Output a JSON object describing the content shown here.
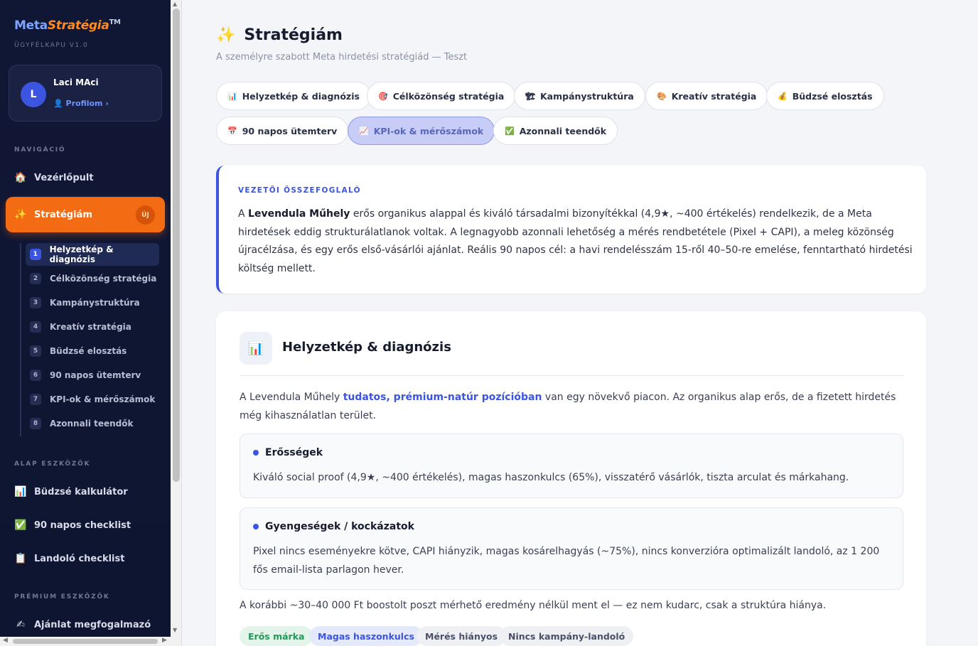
{
  "brand": {
    "part1": "Meta",
    "part2": "Stratégia",
    "tm": "TM",
    "subtitle": "ÜGYFÉLKAPU V1.0"
  },
  "profile": {
    "initial": "L",
    "name": "Laci MAci",
    "link": "Profilom ›"
  },
  "nav": {
    "section_label": "NAVIGÁCIÓ",
    "dashboard": {
      "icon": "🏠",
      "label": "Vezérlőpult"
    },
    "strategy": {
      "icon": "✨",
      "label": "Stratégiám",
      "badge": "ÚJ"
    },
    "sub_items": [
      {
        "num": "1",
        "label": "Helyzetkép & diagnózis"
      },
      {
        "num": "2",
        "label": "Célközönség stratégia"
      },
      {
        "num": "3",
        "label": "Kampánystruktúra"
      },
      {
        "num": "4",
        "label": "Kreatív stratégia"
      },
      {
        "num": "5",
        "label": "Büdzsé elosztás"
      },
      {
        "num": "6",
        "label": "90 napos ütemterv"
      },
      {
        "num": "7",
        "label": "KPI-ok & mérőszámok"
      },
      {
        "num": "8",
        "label": "Azonnali teendők"
      }
    ]
  },
  "basic_tools": {
    "section_label": "ALAP ESZKÖZÖK",
    "items": [
      {
        "icon": "📊",
        "label": "Büdzsé kalkulátor"
      },
      {
        "icon": "✅",
        "label": "90 napos checklist"
      },
      {
        "icon": "📋",
        "label": "Landoló checklist"
      }
    ]
  },
  "premium_tools": {
    "section_label": "PRÉMIUM ESZKÖZÖK",
    "items": [
      {
        "icon": "✍",
        "label": "Ajánlat megfogalmazó"
      }
    ]
  },
  "page": {
    "title_icon": "✨",
    "title": "Stratégiám",
    "subtitle": "A személyre szabott Meta hirdetési stratégiád — Teszt"
  },
  "tabs": [
    {
      "icon": "📊",
      "label": "Helyzetkép & diagnózis"
    },
    {
      "icon": "🎯",
      "label": "Célközönség stratégia"
    },
    {
      "icon": "🏗",
      "label": "Kampánystruktúra"
    },
    {
      "icon": "🎨",
      "label": "Kreatív stratégia"
    },
    {
      "icon": "💰",
      "label": "Büdzsé elosztás"
    },
    {
      "icon": "📅",
      "label": "90 napos ütemterv"
    },
    {
      "icon": "📈",
      "label": "KPI-ok & mérőszámok"
    },
    {
      "icon": "✅",
      "label": "Azonnali teendők"
    }
  ],
  "summary": {
    "label": "VEZETŐI ÖSSZEFOGLALÓ",
    "prefix": "A ",
    "brand_name": "Levendula Műhely",
    "text": " erős organikus alappal és kiváló társadalmi bizonyítékkal (4,9★, ~400 értékelés) rendelkezik, de a Meta hirdetések eddig strukturálatlanok voltak. A legnagyobb azonnali lehetőség a mérés rendbetétele (Pixel + CAPI), a meleg közönség újracélzása, és egy erős első-vásárlói ajánlat. Reális 90 napos cél: a havi rendelésszám 15-ről 40–50-re emelése, fenntartható hirdetési költség mellett."
  },
  "section": {
    "icon": "📊",
    "title": "Helyzetkép & diagnózis",
    "intro_before": "A Levendula Műhely ",
    "intro_highlight": "tudatos, prémium-natúr pozícióban",
    "intro_after": " van egy növekvő piacon. Az organikus alap erős, de a fizetett hirdetés még kihasználatlan terület.",
    "strengths": {
      "title": "Erősségek",
      "text": "Kiváló social proof (4,9★, ~400 értékelés), magas haszonkulcs (65%), visszatérő vásárlók, tiszta arculat és márkahang."
    },
    "weaknesses": {
      "title": "Gyengeségek / kockázatok",
      "text": "Pixel nincs eseményekre kötve, CAPI hiányzik, magas kosárelhagyás (~75%), nincs konverzióra optimalizált landoló, az 1 200 fős email-lista parlagon hever."
    },
    "outro": "A korábbi ~30–40 000 Ft boostolt poszt mérhető eredmény nélkül ment el — ez nem kudarc, csak a struktúra hiánya.",
    "tags": [
      {
        "label": "Erős márka",
        "bg": "#e3f5ea",
        "fg": "#1f9a55"
      },
      {
        "label": "Magas haszonkulcs",
        "bg": "#e4e9fc",
        "fg": "#3c55e0"
      },
      {
        "label": "Mérés hiányos",
        "bg": "#eef0f4",
        "fg": "#4a5068"
      },
      {
        "label": "Nincs kampány-landoló",
        "bg": "#eef0f4",
        "fg": "#4a5068"
      }
    ]
  },
  "colors": {
    "accent": "#3c55e0",
    "orange": "#f36b12",
    "sidebar": "#101735"
  }
}
